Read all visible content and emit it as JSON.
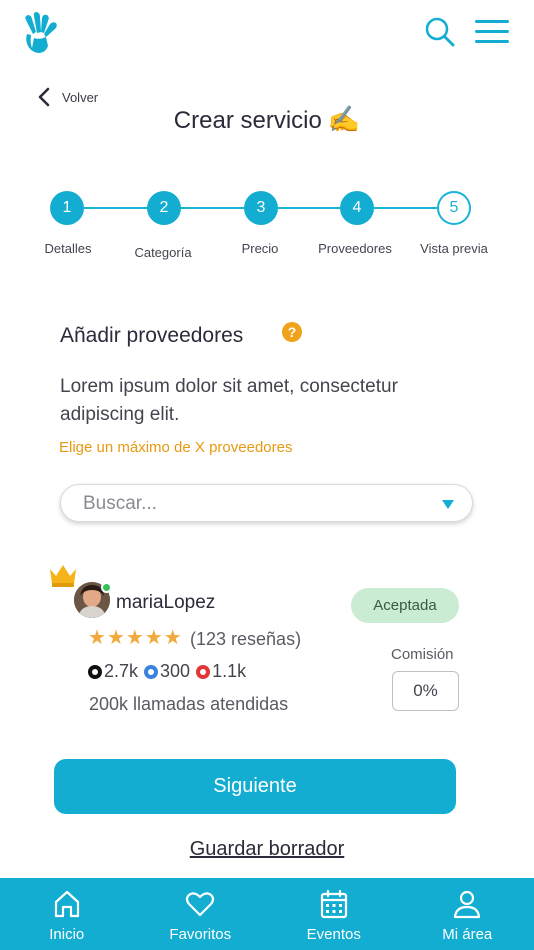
{
  "header": {
    "logo_icon": "hand-logo-icon",
    "search_icon": "search-icon",
    "menu_icon": "hamburger-menu-icon",
    "back_label": "Volver",
    "title": "Crear servicio",
    "title_emoji": "✍"
  },
  "stepper": {
    "steps": [
      {
        "number": "1",
        "label": "Detalles"
      },
      {
        "number": "2",
        "label": "Categoría"
      },
      {
        "number": "3",
        "label": "Precio"
      },
      {
        "number": "4",
        "label": "Proveedores"
      },
      {
        "number": "5",
        "label": "Vista previa"
      }
    ],
    "current_step": 4
  },
  "section": {
    "title": "Añadir proveedores",
    "help": "?",
    "description": "Lorem ipsum dolor sit amet, consectetur adipiscing elit.",
    "hint": "Elige un máximo de  X proveedores"
  },
  "search": {
    "placeholder": "Buscar...",
    "value": ""
  },
  "provider": {
    "username": "mariaLopez",
    "status": "Aceptada",
    "rating_stars": 5,
    "reviews": "(123 reseñas)",
    "socials": [
      {
        "icon": "tiktok-icon",
        "value": "2.7k"
      },
      {
        "icon": "twitter-icon",
        "value": "300"
      },
      {
        "icon": "youtube-icon",
        "value": "1.1k"
      }
    ],
    "calls": "200k llamadas atendidas",
    "commission_label": "Comisión",
    "commission_value": "0%"
  },
  "actions": {
    "next_label": "Siguiente",
    "draft_label": "Guardar borrador"
  },
  "bottom_nav": {
    "items": [
      {
        "label": "Inicio",
        "icon": "home-icon"
      },
      {
        "label": "Favoritos",
        "icon": "heart-icon"
      },
      {
        "label": "Eventos",
        "icon": "calendar-icon"
      },
      {
        "label": "Mi área",
        "icon": "user-icon"
      }
    ]
  },
  "colors": {
    "primary": "#12add1",
    "accent": "#f0a21c",
    "success_bg": "#c9ecd2"
  }
}
